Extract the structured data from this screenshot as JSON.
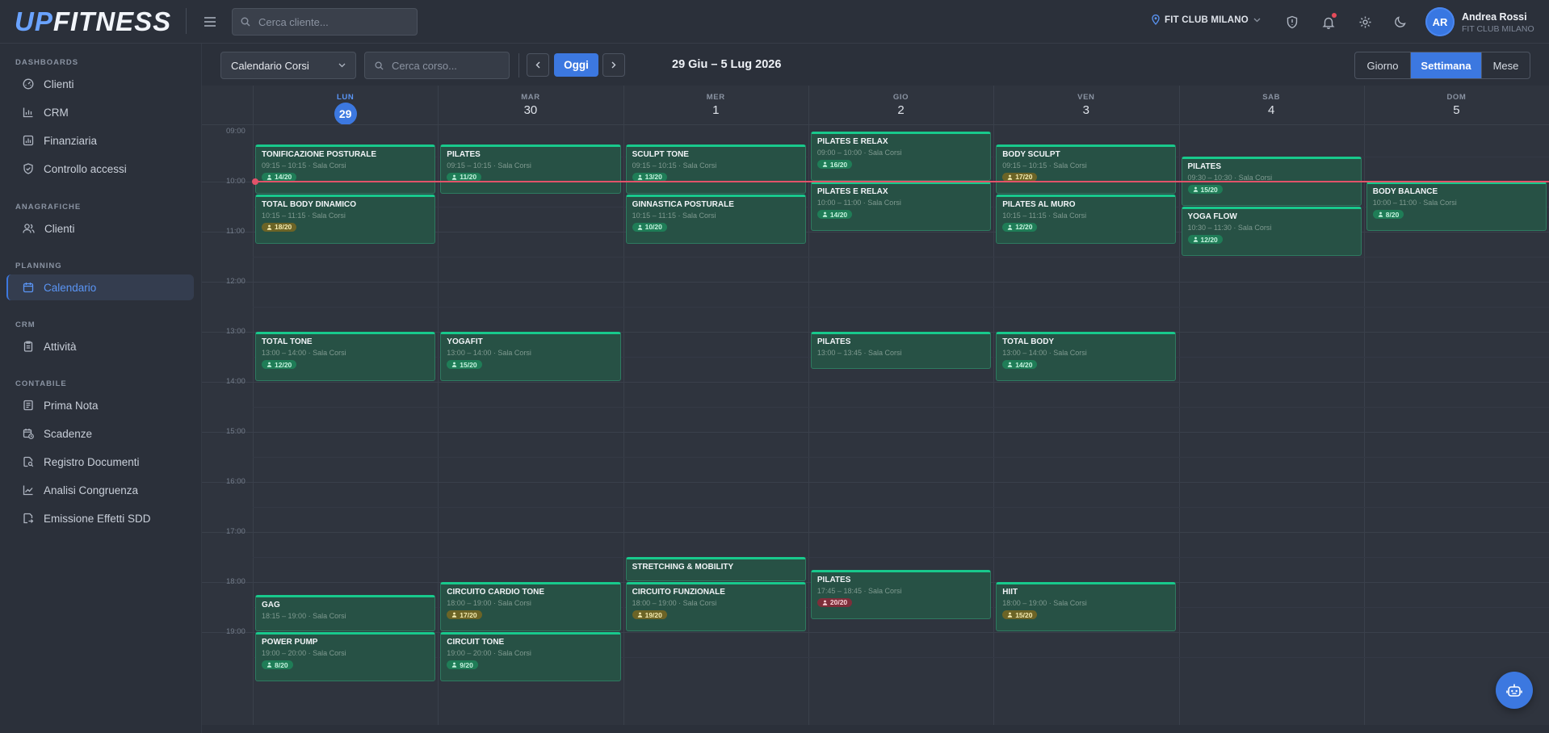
{
  "brand": {
    "logo_up": "UP",
    "logo_rest": "FITNESS"
  },
  "header": {
    "search_placeholder": "Cerca cliente...",
    "club": "FIT CLUB MILANO",
    "user": {
      "initials": "AR",
      "name": "Andrea Rossi",
      "club": "FIT CLUB MILANO"
    }
  },
  "sidebar": {
    "sections": [
      {
        "title": "DASHBOARDS",
        "items": [
          {
            "label": "Clienti",
            "icon": "gauge-icon"
          },
          {
            "label": "CRM",
            "icon": "bar-chart-icon"
          },
          {
            "label": "Finanziaria",
            "icon": "report-icon"
          },
          {
            "label": "Controllo accessi",
            "icon": "shield-check-icon"
          }
        ]
      },
      {
        "title": "ANAGRAFICHE",
        "items": [
          {
            "label": "Clienti",
            "icon": "users-icon"
          }
        ]
      },
      {
        "title": "PLANNING",
        "items": [
          {
            "label": "Calendario",
            "icon": "calendar-icon",
            "active": true
          }
        ]
      },
      {
        "title": "CRM",
        "items": [
          {
            "label": "Attività",
            "icon": "clipboard-icon"
          }
        ]
      },
      {
        "title": "CONTABILE",
        "items": [
          {
            "label": "Prima Nota",
            "icon": "ledger-icon"
          },
          {
            "label": "Scadenze",
            "icon": "calendar-clock-icon"
          },
          {
            "label": "Registro Documenti",
            "icon": "document-search-icon"
          },
          {
            "label": "Analisi Congruenza",
            "icon": "trend-icon"
          },
          {
            "label": "Emissione Effetti SDD",
            "icon": "bank-transfer-icon"
          }
        ]
      }
    ]
  },
  "toolbar": {
    "calendar_select": "Calendario Corsi",
    "course_search_placeholder": "Cerca corso...",
    "today_label": "Oggi",
    "range_title": "29 Giu – 5 Lug 2026",
    "views": [
      {
        "label": "Giorno",
        "active": false
      },
      {
        "label": "Settimana",
        "active": true
      },
      {
        "label": "Mese",
        "active": false
      }
    ]
  },
  "calendar": {
    "days": [
      {
        "name": "LUN",
        "num": "29",
        "today": true
      },
      {
        "name": "MAR",
        "num": "30"
      },
      {
        "name": "MER",
        "num": "1"
      },
      {
        "name": "GIO",
        "num": "2"
      },
      {
        "name": "VEN",
        "num": "3"
      },
      {
        "name": "SAB",
        "num": "4"
      },
      {
        "name": "DOM",
        "num": "5"
      }
    ],
    "hours": [
      "09:00",
      "10:00",
      "11:00",
      "12:00",
      "13:00",
      "14:00",
      "15:00",
      "16:00",
      "17:00",
      "18:00",
      "19:00"
    ],
    "now_time": "10:00",
    "events": [
      {
        "day": 0,
        "title": "TONIFICAZIONE POSTURALE",
        "start": "09:15",
        "end": "10:15",
        "room": "Sala Corsi",
        "booked": "14/20",
        "status": "ok"
      },
      {
        "day": 0,
        "title": "TOTAL BODY DINAMICO",
        "start": "10:15",
        "end": "11:15",
        "room": "Sala Corsi",
        "booked": "18/20",
        "status": "warn"
      },
      {
        "day": 0,
        "title": "TOTAL TONE",
        "start": "13:00",
        "end": "14:00",
        "room": "Sala Corsi",
        "booked": "12/20",
        "status": "ok"
      },
      {
        "day": 0,
        "title": "GAG",
        "start": "18:15",
        "end": "19:00",
        "room": "Sala Corsi",
        "booked": "",
        "status": "ok"
      },
      {
        "day": 0,
        "title": "POWER PUMP",
        "start": "19:00",
        "end": "20:00",
        "room": "Sala Corsi",
        "booked": "8/20",
        "status": "ok"
      },
      {
        "day": 1,
        "title": "PILATES",
        "start": "09:15",
        "end": "10:15",
        "room": "Sala Corsi",
        "booked": "11/20",
        "status": "ok"
      },
      {
        "day": 1,
        "title": "YOGAFIT",
        "start": "13:00",
        "end": "14:00",
        "room": "Sala Corsi",
        "booked": "15/20",
        "status": "ok"
      },
      {
        "day": 1,
        "title": "CIRCUITO CARDIO TONE",
        "start": "18:00",
        "end": "19:00",
        "room": "Sala Corsi",
        "booked": "17/20",
        "status": "warn"
      },
      {
        "day": 1,
        "title": "CIRCUIT TONE",
        "start": "19:00",
        "end": "20:00",
        "room": "Sala Corsi",
        "booked": "9/20",
        "status": "ok"
      },
      {
        "day": 2,
        "title": "SCULPT TONE",
        "start": "09:15",
        "end": "10:15",
        "room": "Sala Corsi",
        "booked": "13/20",
        "status": "ok"
      },
      {
        "day": 2,
        "title": "GINNASTICA POSTURALE",
        "start": "10:15",
        "end": "11:15",
        "room": "Sala Corsi",
        "booked": "10/20",
        "status": "ok"
      },
      {
        "day": 2,
        "title": "STRETCHING & MOBILITY",
        "start": "17:30",
        "end": "18:00",
        "room": "",
        "booked": "",
        "status": "ok"
      },
      {
        "day": 2,
        "title": "CIRCUITO FUNZIONALE",
        "start": "18:00",
        "end": "19:00",
        "room": "Sala Corsi",
        "booked": "19/20",
        "status": "warn"
      },
      {
        "day": 3,
        "title": "PILATES E RELAX",
        "start": "09:00",
        "end": "10:00",
        "room": "Sala Corsi",
        "booked": "16/20",
        "status": "ok"
      },
      {
        "day": 3,
        "title": "PILATES E RELAX",
        "start": "10:00",
        "end": "11:00",
        "room": "Sala Corsi",
        "booked": "14/20",
        "status": "ok"
      },
      {
        "day": 3,
        "title": "PILATES",
        "start": "13:00",
        "end": "13:45",
        "room": "Sala Corsi",
        "booked": "",
        "status": "ok"
      },
      {
        "day": 3,
        "title": "PILATES",
        "start": "17:45",
        "end": "18:45",
        "room": "Sala Corsi",
        "booked": "20/20",
        "status": "full"
      },
      {
        "day": 4,
        "title": "BODY SCULPT",
        "start": "09:15",
        "end": "10:15",
        "room": "Sala Corsi",
        "booked": "17/20",
        "status": "warn"
      },
      {
        "day": 4,
        "title": "PILATES AL MURO",
        "start": "10:15",
        "end": "11:15",
        "room": "Sala Corsi",
        "booked": "12/20",
        "status": "ok"
      },
      {
        "day": 4,
        "title": "TOTAL BODY",
        "start": "13:00",
        "end": "14:00",
        "room": "Sala Corsi",
        "booked": "14/20",
        "status": "ok"
      },
      {
        "day": 4,
        "title": "HIIT",
        "start": "18:00",
        "end": "19:00",
        "room": "Sala Corsi",
        "booked": "15/20",
        "status": "warn"
      },
      {
        "day": 5,
        "title": "PILATES",
        "start": "09:30",
        "end": "10:30",
        "room": "Sala Corsi",
        "booked": "15/20",
        "status": "ok"
      },
      {
        "day": 5,
        "title": "YOGA FLOW",
        "start": "10:30",
        "end": "11:30",
        "room": "Sala Corsi",
        "booked": "12/20",
        "status": "ok"
      },
      {
        "day": 6,
        "title": "BODY BALANCE",
        "start": "10:00",
        "end": "11:00",
        "room": "Sala Corsi",
        "booked": "8/20",
        "status": "ok"
      }
    ]
  }
}
